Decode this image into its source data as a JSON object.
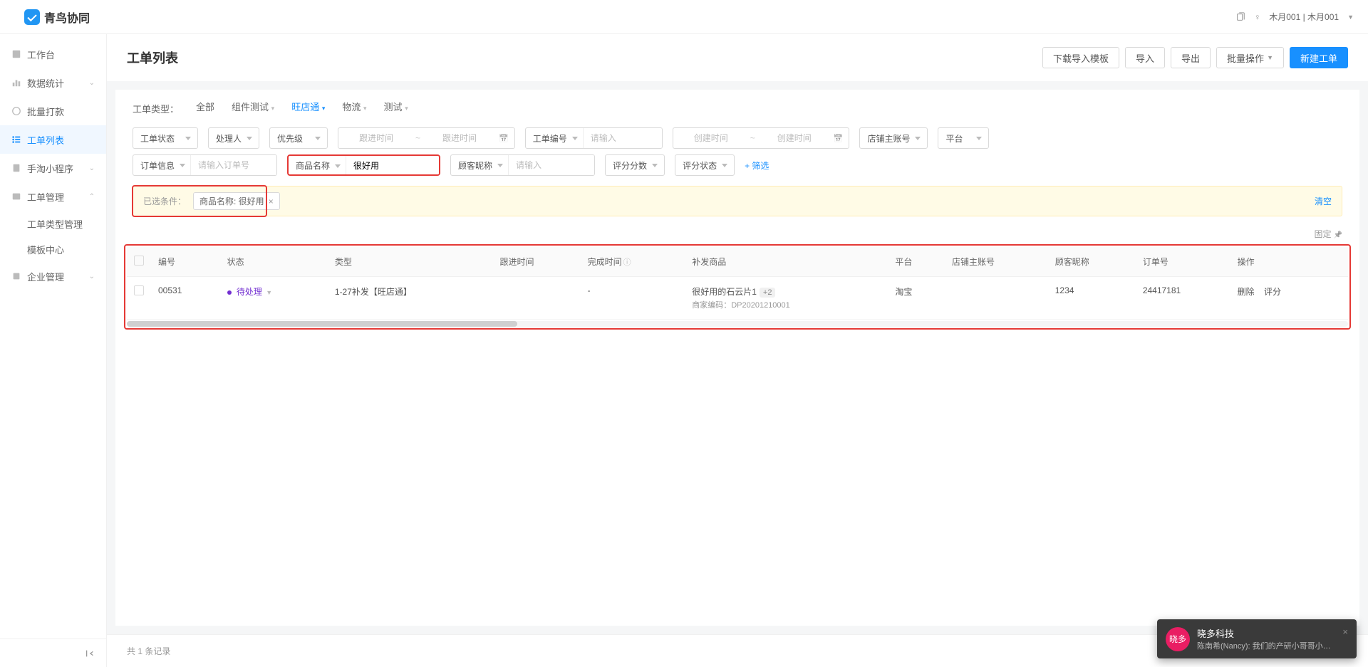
{
  "app": {
    "name": "青鸟协同"
  },
  "user": {
    "display": "木月001 | 木月001"
  },
  "sidebar": {
    "items": [
      {
        "label": "工作台",
        "icon": "home"
      },
      {
        "label": "数据统计",
        "icon": "chart",
        "expandable": true
      },
      {
        "label": "批量打款",
        "icon": "money"
      },
      {
        "label": "工单列表",
        "icon": "list",
        "active": true
      },
      {
        "label": "手淘小程序",
        "icon": "app",
        "expandable": true
      },
      {
        "label": "工单管理",
        "icon": "manage",
        "expandable": true,
        "expanded": true
      },
      {
        "label": "企业管理",
        "icon": "enterprise",
        "expandable": true
      }
    ],
    "subitems": [
      {
        "label": "工单类型管理"
      },
      {
        "label": "模板中心"
      }
    ]
  },
  "page": {
    "title": "工单列表",
    "actions": {
      "download_template": "下载导入模板",
      "import": "导入",
      "export": "导出",
      "batch": "批量操作",
      "create": "新建工单"
    }
  },
  "tabs": {
    "label": "工单类型：",
    "items": [
      "全部",
      "组件测试",
      "旺店通",
      "物流",
      "测试"
    ],
    "active": "旺店通"
  },
  "filters": {
    "status": "工单状态",
    "handler": "处理人",
    "priority": "优先级",
    "follow_time": "跟进时间",
    "ticket_no_label": "工单编号",
    "ticket_no_ph": "请输入",
    "create_time": "创建时间",
    "shop_account": "店铺主账号",
    "platform": "平台",
    "order_info_label": "订单信息",
    "order_info_ph": "请输入订单号",
    "product_name_label": "商品名称",
    "product_name_value": "很好用",
    "customer_nick_label": "顾客昵称",
    "customer_nick_ph": "请输入",
    "rating_score": "评分分数",
    "rating_status": "评分状态",
    "filter_link": "+ 筛选"
  },
  "chips": {
    "label": "已选条件：",
    "chip_text": "商品名称: 很好用",
    "clear": "清空"
  },
  "pin": {
    "label": "固定"
  },
  "table": {
    "headers": {
      "no": "编号",
      "status": "状态",
      "type": "类型",
      "follow_time": "跟进时间",
      "complete_time": "完成时间",
      "product": "补发商品",
      "platform": "平台",
      "shop_account": "店铺主账号",
      "customer": "顾客昵称",
      "order_no": "订单号",
      "actions": "操作"
    },
    "rows": [
      {
        "no": "00531",
        "status": "待处理",
        "type": "1-27补发【旺店通】",
        "follow_time": "",
        "complete_time": "-",
        "product_main": "很好用的石云片1",
        "product_sub": "商家编码：DP20201210001",
        "product_badge": "+2",
        "platform": "淘宝",
        "shop_account": "",
        "customer": "1234",
        "order_no": "24417181",
        "action_delete": "删除",
        "action_rate": "评分"
      }
    ]
  },
  "footer": {
    "total_text": "共 1 条记录"
  },
  "toast": {
    "avatar": "晓多",
    "title": "晓多科技",
    "msg": "陈南希(Nancy): 我们的产研小哥哥小…"
  }
}
